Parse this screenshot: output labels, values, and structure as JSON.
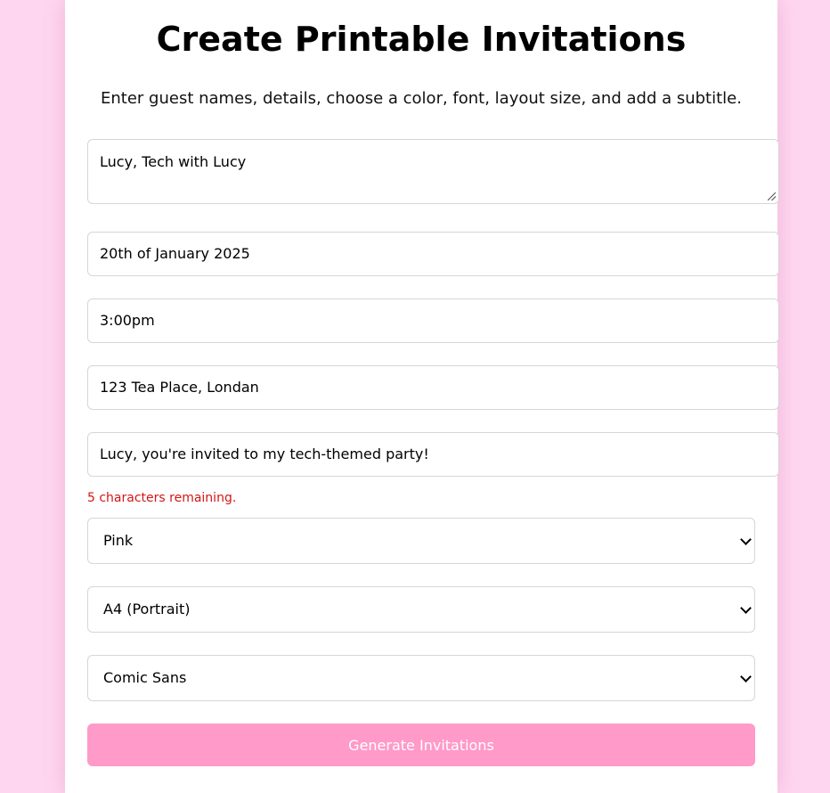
{
  "header": {
    "title": "Create Printable Invitations",
    "instructions": "Enter guest names, details, choose a color, font, layout size, and add a subtitle."
  },
  "form": {
    "guest_names": "Lucy, Tech with Lucy",
    "date": "20th of January 2025",
    "time": "3:00pm",
    "location": "123 Tea Place, Londan",
    "invite_subtitle": "Lucy, you're invited to my tech-themed party!",
    "char_counter": "5 characters remaining.",
    "color_select": "Pink",
    "layout_select": "A4 (Portrait)",
    "font_select": "Comic Sans",
    "generate_label": "Generate Invitations"
  },
  "colors": {
    "background": "#fed6ef",
    "button": "#ff9ac9",
    "counter_text": "#d41515"
  }
}
